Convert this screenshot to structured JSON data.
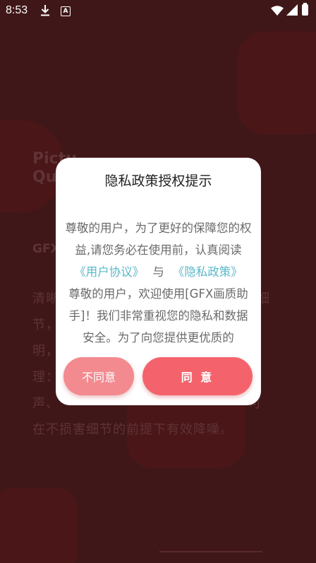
{
  "status_bar": {
    "time": "8:53",
    "icons": [
      "download-icon",
      "a-icon",
      "wifi-icon",
      "cell-signal-icon",
      "battery-icon"
    ]
  },
  "background": {
    "title": "Picture Qu...",
    "subtitle": "GFX...",
    "paragraph": "清晰 ... 细节， ... 明， ... 处理： ... 噪声、 ... 可在不损害细节的前提下有效降噪。"
  },
  "dialog": {
    "title": "隐私政策授权提示",
    "body_intro": "尊敬的用户，为了更好的保障您的权益,请您务必在使用前，认真阅读",
    "user_agreement_link": "《用户协议》",
    "conjunction": "与",
    "privacy_policy_link": "《隐私政策》",
    "body_more": "尊敬的用户，欢迎使用[GFX画质助手]！我们非常重视您的隐私和数据安全。为了向您提供更优质的",
    "disagree_label": "不同意",
    "agree_label": "同 意"
  },
  "colors": {
    "overlay_bg": "#401718",
    "dialog_bg": "#ffffff",
    "link": "#5bb8c8",
    "agree_button": "#f4636c",
    "disagree_button": "#f28a90"
  }
}
